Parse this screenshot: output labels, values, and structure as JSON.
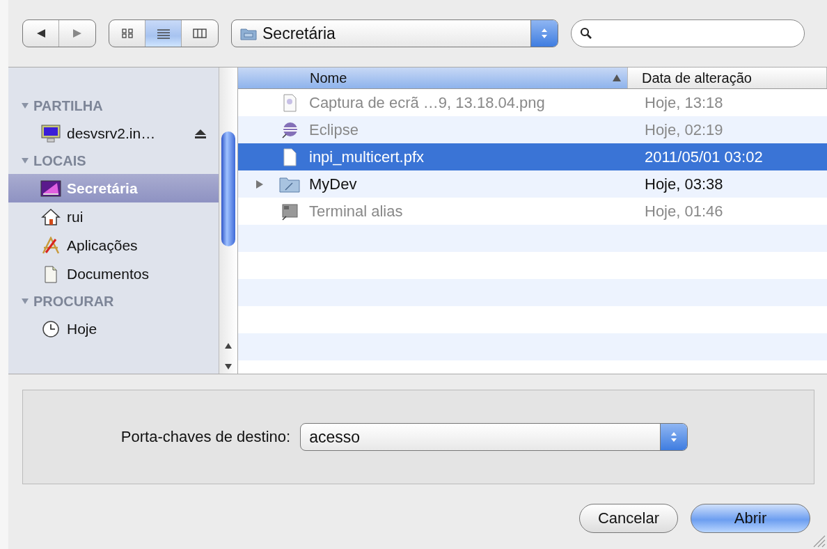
{
  "toolbar": {
    "location": "Secretária",
    "views": [
      {
        "kind": "icons",
        "selected": false
      },
      {
        "kind": "list",
        "selected": true
      },
      {
        "kind": "columns",
        "selected": false
      }
    ]
  },
  "sidebar": {
    "sections": [
      {
        "title": "PARTILHA",
        "expanded": true,
        "items": [
          {
            "label": "desvsrv2.in…",
            "kind": "monitor",
            "eject": true,
            "selected": false
          }
        ]
      },
      {
        "title": "LOCAIS",
        "expanded": true,
        "items": [
          {
            "label": "Secretária",
            "kind": "desktop",
            "eject": false,
            "selected": true
          },
          {
            "label": "rui",
            "kind": "home",
            "eject": false,
            "selected": false
          },
          {
            "label": "Aplicações",
            "kind": "apps",
            "eject": false,
            "selected": false
          },
          {
            "label": "Documentos",
            "kind": "docs",
            "eject": false,
            "selected": false
          }
        ]
      },
      {
        "title": "PROCURAR",
        "expanded": true,
        "items": [
          {
            "label": "Hoje",
            "kind": "clock",
            "eject": false,
            "selected": false
          }
        ]
      }
    ]
  },
  "table": {
    "columns": [
      {
        "label": "Nome",
        "sorted": true
      },
      {
        "label": "Data de alteração",
        "sorted": false
      }
    ],
    "rows": [
      {
        "name": "Captura de ecrã …9, 13.18.04.png",
        "date": "Hoje, 13:18",
        "kind": "image",
        "enabled": false,
        "selected": false,
        "folder": false
      },
      {
        "name": "Eclipse",
        "date": "Hoje, 02:19",
        "kind": "app",
        "enabled": false,
        "selected": false,
        "folder": false
      },
      {
        "name": "inpi_multicert.pfx",
        "date": "2011/05/01 03:02",
        "kind": "file",
        "enabled": true,
        "selected": true,
        "folder": false
      },
      {
        "name": "MyDev",
        "date": "Hoje, 03:38",
        "kind": "folder",
        "enabled": true,
        "selected": false,
        "folder": true
      },
      {
        "name": "Terminal alias",
        "date": "Hoje, 01:46",
        "kind": "terminal",
        "enabled": false,
        "selected": false,
        "folder": false
      }
    ]
  },
  "options": {
    "label": "Porta-chaves de destino:",
    "value": "acesso"
  },
  "buttons": [
    {
      "label": "Cancelar",
      "default": false
    },
    {
      "label": "Abrir",
      "default": true
    }
  ]
}
